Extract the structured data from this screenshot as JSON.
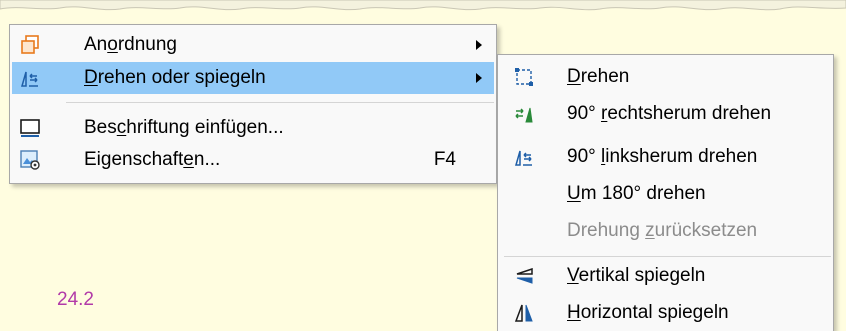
{
  "document": {
    "number_label": "24.2"
  },
  "context_menu": {
    "items": [
      {
        "pre": "An",
        "acc": "o",
        "post": "rdnung",
        "icon": "arrange-icon",
        "submenu": true
      },
      {
        "pre": "",
        "acc": "D",
        "post": "rehen oder spiegeln",
        "icon": "rotate-flip-icon",
        "submenu": true,
        "highlighted": true
      },
      {
        "pre": "Bes",
        "acc": "c",
        "post": "hriftung einfügen...",
        "icon": "insert-caption-icon"
      },
      {
        "pre": "Eigenschaft",
        "acc": "e",
        "post": "n...",
        "icon": "properties-icon",
        "shortcut": "F4"
      }
    ]
  },
  "submenu": {
    "items": [
      {
        "pre": "",
        "acc": "D",
        "post": "rehen",
        "icon": "rotate-icon"
      },
      {
        "pre": "90° ",
        "acc": "r",
        "post": "echtsherum drehen",
        "icon": "rotate-right-icon"
      },
      {
        "pre": "90° ",
        "acc": "l",
        "post": "inksherum drehen",
        "icon": "rotate-left-icon"
      },
      {
        "pre": "",
        "acc": "U",
        "post": "m 180° drehen",
        "icon": ""
      },
      {
        "pre": "Drehung ",
        "acc": "z",
        "post": "urücksetzen",
        "icon": "",
        "disabled": true
      },
      {
        "pre": "",
        "acc": "V",
        "post": "ertikal spiegeln",
        "icon": "flip-vertical-icon"
      },
      {
        "pre": "",
        "acc": "H",
        "post": "orizontal spiegeln",
        "icon": "flip-horizontal-icon"
      }
    ]
  }
}
